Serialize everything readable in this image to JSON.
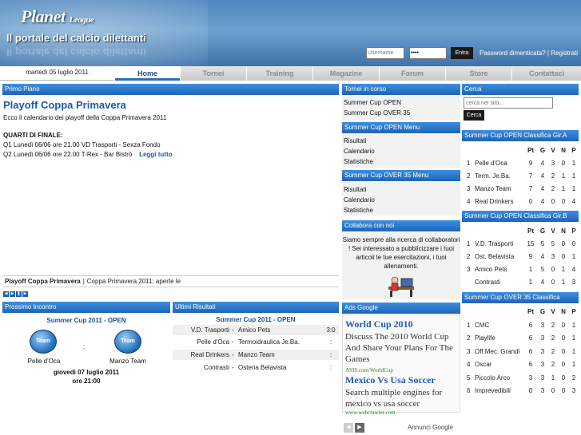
{
  "header": {
    "logo": "Planet",
    "logo_small": "League",
    "tagline": "Il portale del calcio dilettanti",
    "username_placeholder": "Username",
    "password_value": "••••",
    "login_button": "Entra",
    "links": "Password dimenticata? | Registrati"
  },
  "nav": {
    "date": "martedì 05 luglio 2011",
    "items": [
      "Home",
      "Tornei",
      "Training",
      "Magazine",
      "Forum",
      "Store",
      "Contattaci"
    ]
  },
  "primo_piano": {
    "header": "Primo Piano",
    "title": "Playoff Coppa Primavera",
    "intro": "Ecco il calendario dei playoff della Coppa Primavera 2011",
    "subtitle": "QUARTI DI FINALE:",
    "line1": "Q1 Lunedì 06/06 ore 21.00 VD Trasporti - Sexza Fondo",
    "line2": "Q2 Lunedì 06/06 ore 22.00 T-Rex - Bar Bistrò",
    "read_more": "Leggi tutto",
    "tab1": "Playoff Coppa Primavera",
    "tab2": "Coppa Primavera 2011: aperte le"
  },
  "prossimo": {
    "header": "Prossimo Incontro",
    "competition": "Summer Cup 2011 - OPEN",
    "home": "Pelle d'Oca",
    "away": "Manzo Team",
    "sep": ":",
    "badge": "Team",
    "date": "giovedì 07 luglio 2011",
    "time": "ore 21:00"
  },
  "ultimi": {
    "header": "Ultimi Risultati",
    "competition": "Summer Cup 2011 - OPEN",
    "rows": [
      {
        "home": "V.D. Trasporti",
        "dash": "-",
        "away": "Amico Pets",
        "score": "3:0"
      },
      {
        "home": "Pelle d'Oca",
        "dash": "-",
        "away": "Termoidraulica Je.Ba.",
        "score": ":"
      },
      {
        "home": "Real Drinkers",
        "dash": "-",
        "away": "Manzo Team",
        "score": ":"
      },
      {
        "home": "Contrasti",
        "dash": "-",
        "away": "Osteria Belavista",
        "score": ":"
      }
    ]
  },
  "middle": {
    "tornei_header": "Tornei in corso",
    "tornei": [
      "Summer Cup OPEN",
      "Summer Cup OVER 35"
    ],
    "open_menu_header": "Summer Cup OPEN Menu",
    "open_menu": [
      "Risultati",
      "Calendario",
      "Statistiche"
    ],
    "over_menu_header": "Summer Cup OVER 35 Menu",
    "over_menu": [
      "Risultati",
      "Calendario",
      "Statistiche"
    ],
    "collabora_header": "Collabora con noi",
    "collabora_text": "Siamo sempre alla ricerca di collaboratori ! Sei interessato a pubblicizzare i tuoi articoli le tue esercitazioni, i tuoi allenamenti.",
    "ads_header": "Ads Google",
    "ad1_title": "World Cup 2010",
    "ad1_text": "Discuss The 2010 World Cup And Share Your Plans For The Games",
    "ad1_url": "ASIS.com/WorldCup",
    "ad2_title": "Mexico Vs Usa Soccer",
    "ad2_text": "Search multiple engines for mexico vs usa soccer",
    "ad2_url": "www.webcrawler.com",
    "ads_by": "Annunci Google"
  },
  "right": {
    "search_header": "Cerca",
    "search_placeholder": "cerca nel sito...",
    "search_button": "Cerca",
    "table_cols": [
      "Pt",
      "G",
      "V",
      "N",
      "P"
    ],
    "group_a": {
      "header": "Summer Cup OPEN Classifica Gir.A",
      "rows": [
        {
          "pos": "1",
          "team": "Pelle d'Oca",
          "pt": "9",
          "g": "4",
          "v": "3",
          "n": "0",
          "p": "1"
        },
        {
          "pos": "2",
          "team": "Term. Je.Ba.",
          "pt": "7",
          "g": "4",
          "v": "2",
          "n": "1",
          "p": "1"
        },
        {
          "pos": "3",
          "team": "Manzo Team",
          "pt": "7",
          "g": "4",
          "v": "2",
          "n": "1",
          "p": "1"
        },
        {
          "pos": "4",
          "team": "Real Drinkers",
          "pt": "0",
          "g": "4",
          "v": "0",
          "n": "0",
          "p": "4"
        }
      ]
    },
    "group_b": {
      "header": "Summer Cup OPEN Classifica Gir.B",
      "rows": [
        {
          "pos": "1",
          "team": "V.D. Trasporti",
          "pt": "15",
          "g": "5",
          "v": "5",
          "n": "0",
          "p": "0"
        },
        {
          "pos": "2",
          "team": "Ost. Belavista",
          "pt": "9",
          "g": "4",
          "v": "3",
          "n": "0",
          "p": "1"
        },
        {
          "pos": "3",
          "team": "Amico Pets",
          "pt": "1",
          "g": "5",
          "v": "0",
          "n": "1",
          "p": "4"
        },
        {
          "pos": "",
          "team": "Contrasti",
          "pt": "1",
          "g": "4",
          "v": "0",
          "n": "1",
          "p": "3"
        }
      ]
    },
    "over35": {
      "header": "Summer Cup OVER 35 Classifica",
      "rows": [
        {
          "pos": "1",
          "team": "CMC",
          "pt": "6",
          "g": "3",
          "v": "2",
          "n": "0",
          "p": "1"
        },
        {
          "pos": "2",
          "team": "Playlife",
          "pt": "6",
          "g": "3",
          "v": "2",
          "n": "0",
          "p": "1"
        },
        {
          "pos": "3",
          "team": "Off.Mec. Grandi",
          "pt": "6",
          "g": "3",
          "v": "2",
          "n": "0",
          "p": "1"
        },
        {
          "pos": "4",
          "team": "Oscar",
          "pt": "6",
          "g": "3",
          "v": "2",
          "n": "0",
          "p": "1"
        },
        {
          "pos": "5",
          "team": "Piccolo Arco",
          "pt": "3",
          "g": "3",
          "v": "1",
          "n": "0",
          "p": "2"
        },
        {
          "pos": "6",
          "team": "Imprevedibili",
          "pt": "0",
          "g": "3",
          "v": "0",
          "n": "0",
          "p": "3"
        }
      ]
    }
  }
}
